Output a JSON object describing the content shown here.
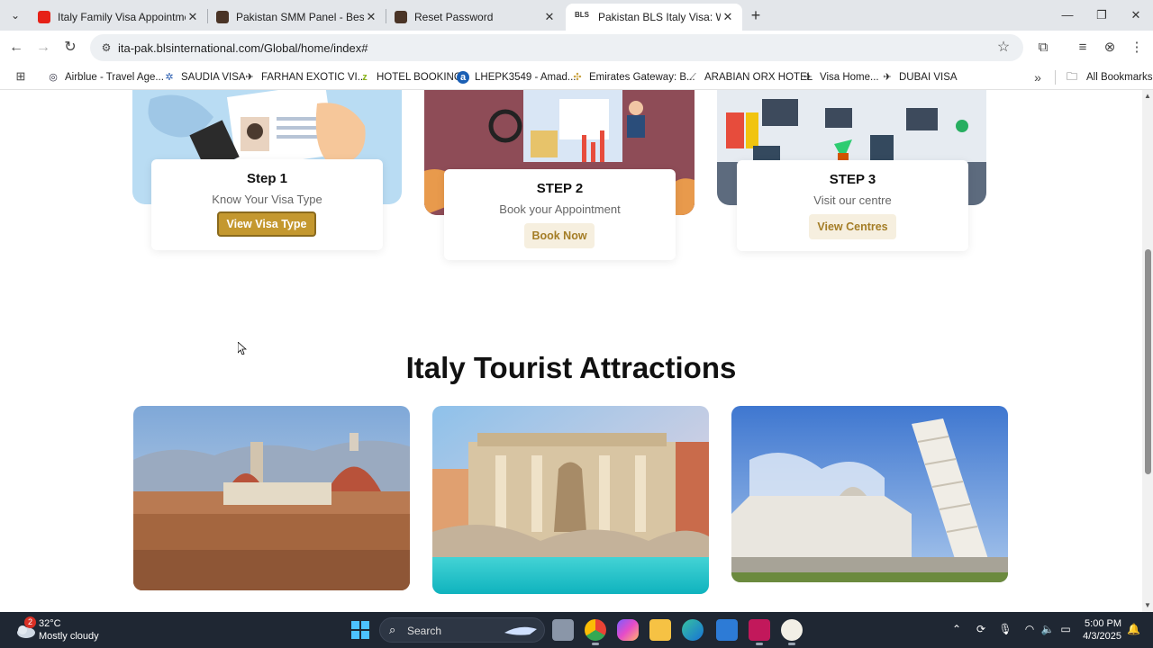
{
  "browser": {
    "tabs": [
      {
        "title": "Italy Family Visa Appointment n",
        "favicon_color": "#e62117"
      },
      {
        "title": "Pakistan SMM Panel - Best Soc",
        "favicon_color": "#4a3426"
      },
      {
        "title": "Reset Password",
        "favicon_color": "#4a3426"
      },
      {
        "title": "Pakistan BLS Italy Visa: Welcom",
        "favicon_text": "BLS",
        "active": true
      }
    ],
    "url": "ita-pak.blsinternational.com/Global/home/index#",
    "bookmarks": [
      {
        "label": "Airblue - Travel Age...",
        "icon": "airblue-icon"
      },
      {
        "label": "SAUDIA VISA",
        "icon": "saudia-icon"
      },
      {
        "label": "FARHAN EXOTIC VI...",
        "icon": "plane-icon"
      },
      {
        "label": "HOTEL BOOKING",
        "icon": "zl-icon"
      },
      {
        "label": "LHEPK3549 - Amad...",
        "icon": "amadeus-icon"
      },
      {
        "label": "Emirates Gateway: B...",
        "icon": "emirates-icon"
      },
      {
        "label": "ARABIAN ORX HOTEL",
        "icon": "orx-icon"
      },
      {
        "label": "Visa Home...",
        "icon": "plane-icon"
      },
      {
        "label": "DUBAI VISA",
        "icon": "plane-icon"
      }
    ],
    "all_bookmarks_label": "All Bookmarks"
  },
  "steps": [
    {
      "title": "Step 1",
      "description": "Know Your Visa Type",
      "button": "View Visa Type"
    },
    {
      "title": "STEP 2",
      "description": "Book your Appointment",
      "button": "Book Now"
    },
    {
      "title": "STEP 3",
      "description": "Visit our centre",
      "button": "View Centres"
    }
  ],
  "attractions": {
    "title": "Italy Tourist Attractions"
  },
  "taskbar": {
    "weather_badge": "2",
    "temperature": "32°C",
    "condition": "Mostly cloudy",
    "search_label": "Search",
    "time": "5:00 PM",
    "date": "4/3/2025"
  },
  "colors": {
    "accent_gold": "#c4982f",
    "soft_gold_bg": "#f6efdf",
    "taskbar": "#1f2733"
  }
}
